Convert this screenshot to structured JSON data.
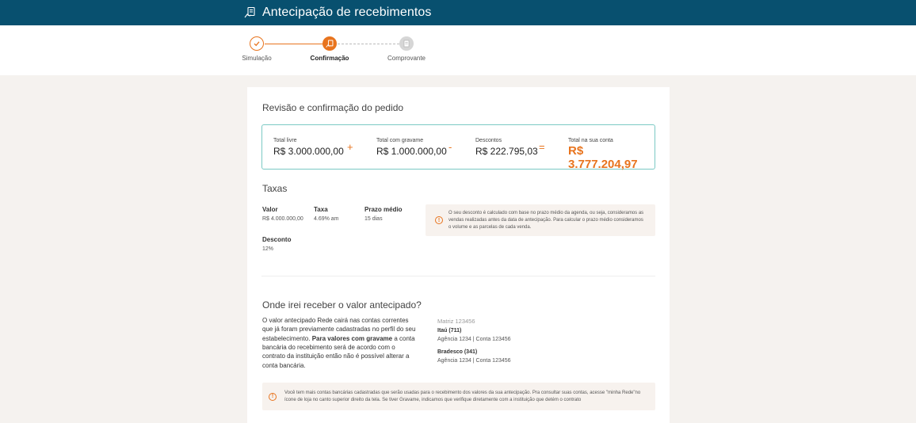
{
  "header": {
    "title": "Antecipação de recebimentos",
    "icon": "receipt-hand-icon"
  },
  "steps": [
    {
      "label": "Simulação",
      "state": "done"
    },
    {
      "label": "Confirmação",
      "state": "current"
    },
    {
      "label": "Comprovante",
      "state": "pending"
    }
  ],
  "review": {
    "title": "Revisão e confirmação do pedido",
    "total_livre": {
      "label": "Total livre",
      "value": "R$ 3.000.000,00"
    },
    "op_plus": "+",
    "total_gravame": {
      "label": "Total com gravame",
      "value": "R$ 1.000.000,00"
    },
    "op_minus": "-",
    "descontos": {
      "label": "Descontos",
      "value": "R$ 222.795,03"
    },
    "op_equals": "=",
    "total_conta": {
      "label": "Total na sua conta",
      "value": "R$ 3.777.204,97"
    }
  },
  "taxas": {
    "title": "Taxas",
    "valor": {
      "label": "Valor",
      "value": "R$ 4.000.000,00"
    },
    "taxa": {
      "label": "Taxa",
      "value": "4.69% am"
    },
    "prazo": {
      "label": "Prazo médio",
      "value": "15 dias"
    },
    "desconto": {
      "label": "Desconto",
      "value": "12%"
    },
    "info": "O seu desconto é calculado com base no prazo médio da agenda, ou seja, consideramos as vendas realizadas antes da data de antecipação. Para calcular o prazo médio consideramos o volume e as parcelas de cada venda."
  },
  "receber": {
    "title": "Onde irei receber o valor antecipado?",
    "para_part1": "O valor antecipado Rede cairá nas contas correntes que já foram previamente cadastradas no perfil do seu estabelecimento. ",
    "para_bold": "Para valores com gravame",
    "para_part2": " a conta bancária do recebimento será de acordo com o contrato da instituição então não é possível alterar a conta bancária.",
    "matriz": "Matriz 123456",
    "banks": [
      {
        "name": "Itaú (711)",
        "agencia": "Agência 1234",
        "conta": "Conta 123456"
      },
      {
        "name": "Bradesco (341)",
        "agencia": "Agência 1234",
        "conta": "Conta 123456"
      }
    ],
    "info": "Você tem mais contas bancárias cadastradas que serão usadas para o recebimento dos valores da sua antecipação. Pra consultar suas contas, acesse \"minha Rede\"no ícone de loja no canto superior direito da tela. Se tiver Gravame, indicamos que verifique diretamente com a instituição que detém o contrato"
  },
  "colors": {
    "header": "#08506f",
    "accent": "#e8741e",
    "summary_border": "#7bc9c4"
  }
}
